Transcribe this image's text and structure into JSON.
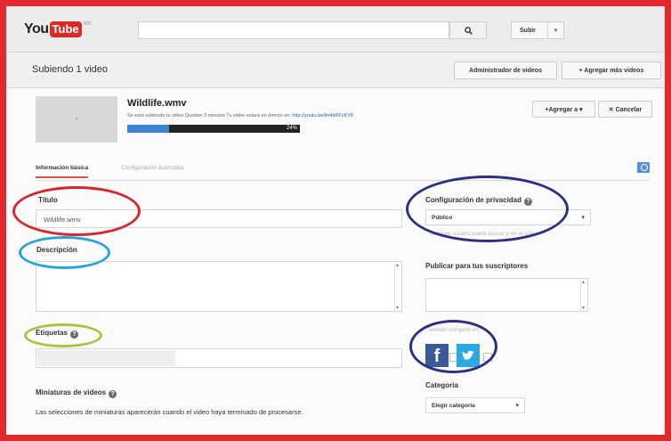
{
  "logo": {
    "part1": "You",
    "part2": "Tube",
    "country": "MX"
  },
  "header": {
    "upload_label": "Subir",
    "upload_caret": "▾"
  },
  "subheader": {
    "title": "Subiendo 1 video",
    "video_manager_label": "Administrador de videos",
    "add_more_label": "+ Agregar más videos"
  },
  "upload": {
    "file_name": "Wildlife.wmv",
    "status_message": "Se está subiendo tu video Quedan 3 minutos.Tu video estará en directo en:",
    "video_link": "http://youtu.be/lm4kRFxKY8",
    "progress_percent": 24,
    "progress_label": "24%",
    "add_to_label": "+Agregar a ▾",
    "cancel_label": "✕ Cancelar"
  },
  "tabs": {
    "basic": "Información básica",
    "advanced": "Configuración avanzada"
  },
  "form": {
    "title_label": "Título",
    "title_value": "Wildlife.wmv",
    "description_label": "Descripción",
    "tags_label": "Etiquetas",
    "thumbnails_label": "Miniaturas de videos",
    "thumbnails_text": "Las selecciones de miniaturas aparecerán cuando el video haya terminado de procesarse."
  },
  "privacy": {
    "label": "Configuración de privacidad",
    "value": "Público",
    "hint": "cualquier usuario puede buscar y ver el video"
  },
  "subscribers": {
    "label": "Publicar para tus suscriptores"
  },
  "share": {
    "label": "También compartir en:",
    "facebook_glyph": "f"
  },
  "category": {
    "label": "Categoría",
    "value": "Elegir categoría"
  },
  "icons": [
    "search-icon",
    "facebook-icon",
    "twitter-icon",
    "help-icon",
    "photo-icon"
  ],
  "colors": {
    "frame": "#e3292b",
    "title_circle": "#d9252b",
    "description_circle": "#27a4dc",
    "tags_circle": "#a9c43a",
    "privacy_circle": "#2d2f86"
  }
}
